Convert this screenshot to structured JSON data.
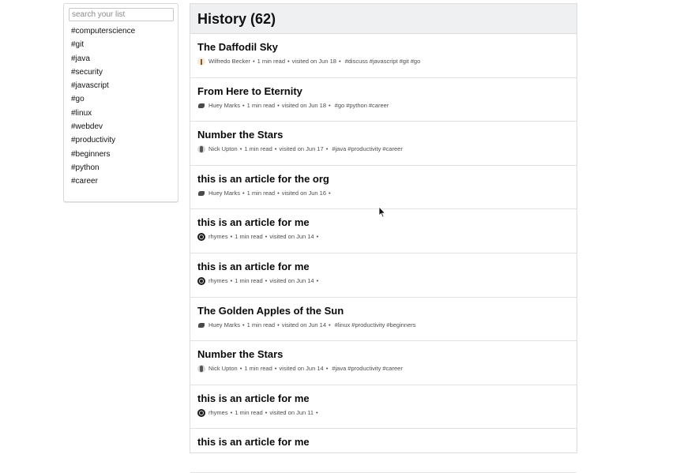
{
  "sidebar": {
    "search_placeholder": "search your list",
    "tags": [
      "#computerscience",
      "#git",
      "#java",
      "#security",
      "#javascript",
      "#go",
      "#linux",
      "#webdev",
      "#productivity",
      "#beginners",
      "#python",
      "#career"
    ]
  },
  "main": {
    "title": "History (62)",
    "items": [
      {
        "title": "The Daffodil Sky",
        "author": "Wilfredo Becker",
        "avatar": "plant-avatar",
        "read": "1 min read",
        "visited": "visited on Jun 18",
        "tags": [
          "#discuss",
          "#javascript",
          "#git",
          "#go"
        ]
      },
      {
        "title": "From Here to Eternity",
        "author": "Huey Marks",
        "avatar": "dog-avatar",
        "read": "1 min read",
        "visited": "visited on Jun 18",
        "tags": [
          "#go",
          "#python",
          "#career"
        ]
      },
      {
        "title": "Number the Stars",
        "author": "Nick Upton",
        "avatar": "person-avatar",
        "read": "1 min read",
        "visited": "visited on Jun 17",
        "tags": [
          "#java",
          "#productivity",
          "#career"
        ]
      },
      {
        "title": "this is an article for the org",
        "author": "Huey Marks",
        "avatar": "dog-avatar",
        "read": "1 min read",
        "visited": "visited on Jun 16",
        "tags": []
      },
      {
        "title": "this is an article for me",
        "author": "rhymes",
        "avatar": "logo-avatar",
        "read": "1 min read",
        "visited": "visited on Jun 14",
        "tags": []
      },
      {
        "title": "this is an article for me",
        "author": "rhymes",
        "avatar": "logo-avatar",
        "read": "1 min read",
        "visited": "visited on Jun 14",
        "tags": []
      },
      {
        "title": "The Golden Apples of the Sun",
        "author": "Huey Marks",
        "avatar": "dog-avatar",
        "read": "1 min read",
        "visited": "visited on Jun 14",
        "tags": [
          "#linux",
          "#productivity",
          "#beginners"
        ]
      },
      {
        "title": "Number the Stars",
        "author": "Nick Upton",
        "avatar": "person-avatar",
        "read": "1 min read",
        "visited": "visited on Jun 14",
        "tags": [
          "#java",
          "#productivity",
          "#career"
        ]
      },
      {
        "title": "this is an article for me",
        "author": "rhymes",
        "avatar": "logo-avatar",
        "read": "1 min read",
        "visited": "visited on Jun 11",
        "tags": []
      },
      {
        "title": "this is an article for me",
        "author": "",
        "avatar": "",
        "read": "",
        "visited": "",
        "tags": []
      }
    ]
  }
}
